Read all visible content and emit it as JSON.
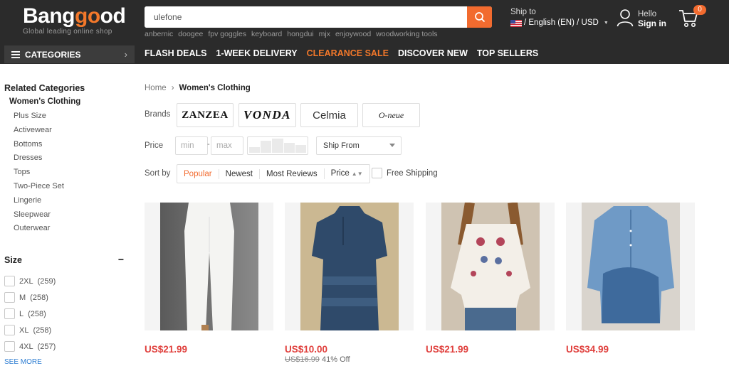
{
  "header": {
    "logo_text": "Banggood",
    "logo_tagline": "Global leading online shop",
    "search_value": "ulefone",
    "hot_words": [
      "anbernic",
      "doogee",
      "fpv goggles",
      "keyboard",
      "hongdui",
      "mjx",
      "enjoywood",
      "woodworking tools"
    ],
    "ship_to_label": "Ship to",
    "ship_to_value": "/ English (EN) / USD",
    "hello": "Hello",
    "sign_in": "Sign in",
    "cart_count": "0"
  },
  "nav": {
    "categories_label": "CATEGORIES",
    "links": [
      "FLASH DEALS",
      "1-WEEK DELIVERY",
      "CLEARANCE SALE",
      "DISCOVER NEW",
      "TOP SELLERS"
    ],
    "highlight_color": "#f3782a"
  },
  "sidebar": {
    "related_title": "Related Categories",
    "current": "Women's Clothing",
    "items": [
      "Plus Size",
      "Activewear",
      "Bottoms",
      "Dresses",
      "Tops",
      "Two-Piece Set",
      "Lingerie",
      "Sleepwear",
      "Outerwear"
    ],
    "size_title": "Size",
    "sizes": [
      {
        "label": "2XL",
        "count": "(259)"
      },
      {
        "label": "M",
        "count": "(258)"
      },
      {
        "label": "L",
        "count": "(258)"
      },
      {
        "label": "XL",
        "count": "(258)"
      },
      {
        "label": "4XL",
        "count": "(257)"
      }
    ],
    "see_more": "SEE MORE"
  },
  "breadcrumb": {
    "home": "Home",
    "current": "Women's Clothing"
  },
  "filters": {
    "brands_label": "Brands",
    "brands": [
      "ZANZEA",
      "VONDA",
      "Celmia",
      "O-neue"
    ],
    "price_label": "Price",
    "min_placeholder": "min",
    "max_placeholder": "max",
    "ship_from": "Ship From",
    "sort_label": "Sort by",
    "sort_options": [
      "Popular",
      "Newest",
      "Most Reviews",
      "Price"
    ],
    "free_shipping": "Free Shipping"
  },
  "products": [
    {
      "price": "US$21.99",
      "old_price": "",
      "discount": ""
    },
    {
      "price": "US$10.00",
      "old_price": "US$16.99",
      "discount": "41% Off"
    },
    {
      "price": "US$21.99",
      "old_price": "",
      "discount": ""
    },
    {
      "price": "US$34.99",
      "old_price": "",
      "discount": ""
    }
  ],
  "colors": {
    "accent": "#f26b2f",
    "price": "#e0403d",
    "header_bg": "#2b2b2b",
    "link": "#2d7dd2"
  }
}
